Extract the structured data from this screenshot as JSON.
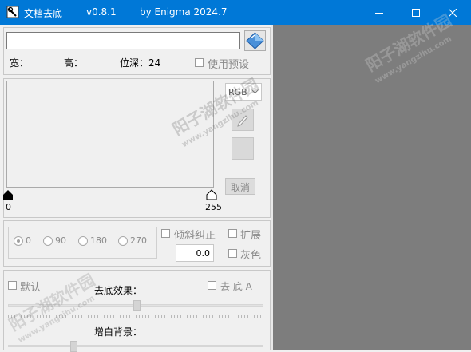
{
  "window": {
    "title": "文档去底",
    "version": "v0.8.1",
    "author": "by Enigma 2024.7"
  },
  "file": {
    "path_value": "",
    "width_label": "宽：",
    "height_label": "高：",
    "depth_label": "位深：24",
    "use_preset_label": "使用预设"
  },
  "histogram": {
    "mode_selected": "RGB",
    "left_value": "0",
    "right_value": "255",
    "cancel_label": "取消"
  },
  "rotation": {
    "options": [
      "0",
      "90",
      "180",
      "270"
    ],
    "selected": "0",
    "deskew_label": "倾斜纠正",
    "expand_label": "扩展",
    "angle_value": "0.0",
    "gray_label": "灰色"
  },
  "effects": {
    "default_label": "默认",
    "effect_label": "去底效果：",
    "remove_bg_label": "去 底 A",
    "whiten_label": "增白背景："
  },
  "watermark": {
    "site_name": "阳子湖软件园",
    "site_url": "www.yangzihu.com"
  }
}
